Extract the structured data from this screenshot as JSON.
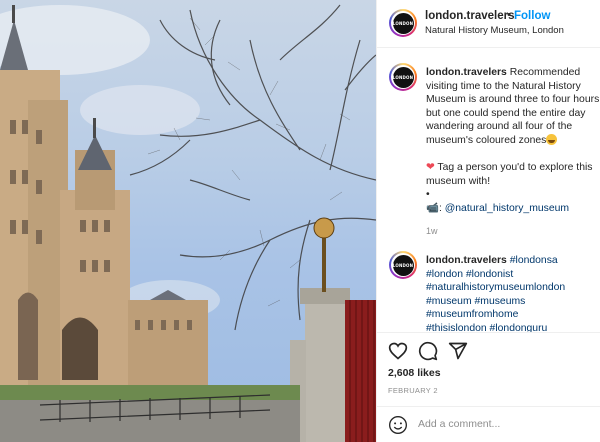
{
  "post": {
    "username": "london.travelers",
    "dot": "•",
    "follow_label": "Follow",
    "location": "Natural History Museum, London",
    "avatar_text": "LONDON"
  },
  "caption": {
    "username": "london.travelers",
    "text": "Recommended visiting time to the Natural History Museum is around three to four hours but one could spend the entire day wandering around all four of the museum's coloured zones",
    "emoji_icon": "grinning-face-emoji",
    "tag_line": "Tag a person you'd to explore this museum with!",
    "bullet": "•",
    "camera_handle": "@natural_history_museum",
    "time": "1w"
  },
  "reply": {
    "username": "london.travelers",
    "hashtags": [
      "#londonsa",
      "#london",
      "#londonist",
      "#naturalhistorymuseumlondon",
      "#museum",
      "#museums",
      "#museumfromhome",
      "#thisislondon",
      "#londonguru"
    ]
  },
  "actions": {
    "icons": [
      "heart-icon",
      "comment-icon",
      "share-icon"
    ],
    "likes": "2,608 likes",
    "date": "FEBRUARY 2",
    "add_comment_placeholder": "Add a comment..."
  },
  "colors": {
    "link_blue": "#0095f6",
    "hashtag": "#00376b",
    "muted": "#8e8e8e",
    "heart_red": "#ed4956"
  }
}
